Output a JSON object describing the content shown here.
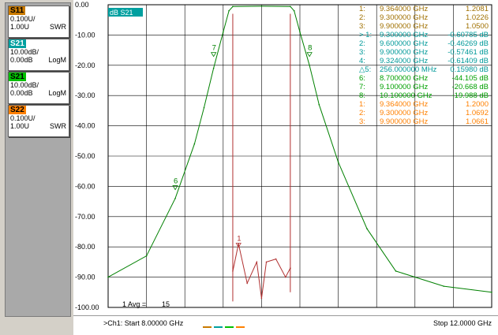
{
  "traces": [
    {
      "name": "S11",
      "scale": "0.100U/",
      "ref": "1.00U",
      "format": "SWR",
      "color": "#c97a00"
    },
    {
      "name": "S21",
      "scale": "10.00dB/",
      "ref": "0.00dB",
      "format": "LogM",
      "color": "#00a0a0"
    },
    {
      "name": "S21",
      "scale": "10.00dB/",
      "ref": "0.00dB",
      "format": "LogM",
      "color": "#00c000"
    },
    {
      "name": "S22",
      "scale": "0.100U/",
      "ref": "1.00U",
      "format": "SWR",
      "color": "#ff8000"
    }
  ],
  "active_trace_label": "dB S21",
  "avg_label": "1 Avg =",
  "avg_value": "15",
  "status": {
    "start": ">Ch1: Start  8.00000 GHz",
    "stop": "Stop  12.0000 GHz"
  },
  "markers": [
    {
      "id": "1:",
      "freq": "9.364000 GHz",
      "value": "1.2081",
      "color": "#a07000"
    },
    {
      "id": "2:",
      "freq": "9.300000 GHz",
      "value": "1.0226",
      "color": "#a07000"
    },
    {
      "id": "3:",
      "freq": "9.900000 GHz",
      "value": "1.0500",
      "color": "#a07000"
    },
    {
      "id": "> 1:",
      "freq": "9.300000 GHz",
      "value": "-0.60785 dB",
      "color": "#009999"
    },
    {
      "id": "2:",
      "freq": "9.600000 GHz",
      "value": "-0.46269 dB",
      "color": "#009999"
    },
    {
      "id": "3:",
      "freq": "9.900000 GHz",
      "value": "-0.57461 dB",
      "color": "#009999"
    },
    {
      "id": "4:",
      "freq": "9.324000 GHz",
      "value": "-0.61409 dB",
      "color": "#009999"
    },
    {
      "id": "△5:",
      "freq": "256.000000 MHz",
      "value": "0.15980 dB",
      "color": "#009999"
    },
    {
      "id": "6:",
      "freq": "8.700000 GHz",
      "value": "-44.105 dB",
      "color": "#00a000"
    },
    {
      "id": "7:",
      "freq": "9.100000 GHz",
      "value": "-20.668 dB",
      "color": "#00a000"
    },
    {
      "id": "8:",
      "freq": "10.100000 GHz",
      "value": "-19.988 dB",
      "color": "#00a000"
    },
    {
      "id": "1:",
      "freq": "9.364000 GHz",
      "value": "1.2000",
      "color": "#ff8000"
    },
    {
      "id": "2:",
      "freq": "9.300000 GHz",
      "value": "1.0692",
      "color": "#ff8000"
    },
    {
      "id": "3:",
      "freq": "9.900000 GHz",
      "value": "1.0661",
      "color": "#ff8000"
    }
  ],
  "chart_data": {
    "type": "line",
    "x_range_ghz": [
      8.0,
      12.0
    ],
    "y_range_db": [
      -100,
      0
    ],
    "y_ticks": [
      "0.00",
      "-10.00",
      "-20.00",
      "-30.00",
      "-40.00",
      "-50.00",
      "-60.00",
      "-70.00",
      "-80.00",
      "-90.00",
      "-100.00"
    ],
    "grid": true,
    "marker_labels": [
      "1",
      "6",
      "7",
      "8"
    ],
    "series": [
      {
        "name": "S21",
        "color": "#008000",
        "x": [
          8.0,
          8.4,
          8.7,
          8.9,
          9.0,
          9.1,
          9.2,
          9.26,
          9.3,
          9.6,
          9.9,
          9.94,
          10.0,
          10.1,
          10.2,
          10.4,
          10.7,
          11.0,
          11.5,
          12.0
        ],
        "y": [
          -90,
          -83,
          -64,
          -46,
          -34,
          -21,
          -9,
          -2,
          -0.6,
          -0.5,
          -0.6,
          -2,
          -9,
          -20,
          -33,
          -52,
          -74,
          -88,
          -93,
          -95
        ]
      },
      {
        "name": "S11",
        "color": "#b03030",
        "x": [
          9.3,
          9.36,
          9.45,
          9.55,
          9.6,
          9.65,
          9.75,
          9.85,
          9.9
        ],
        "y": [
          -88,
          -79,
          -92,
          -85,
          -97,
          -85,
          -84,
          -90,
          -87
        ]
      }
    ]
  }
}
